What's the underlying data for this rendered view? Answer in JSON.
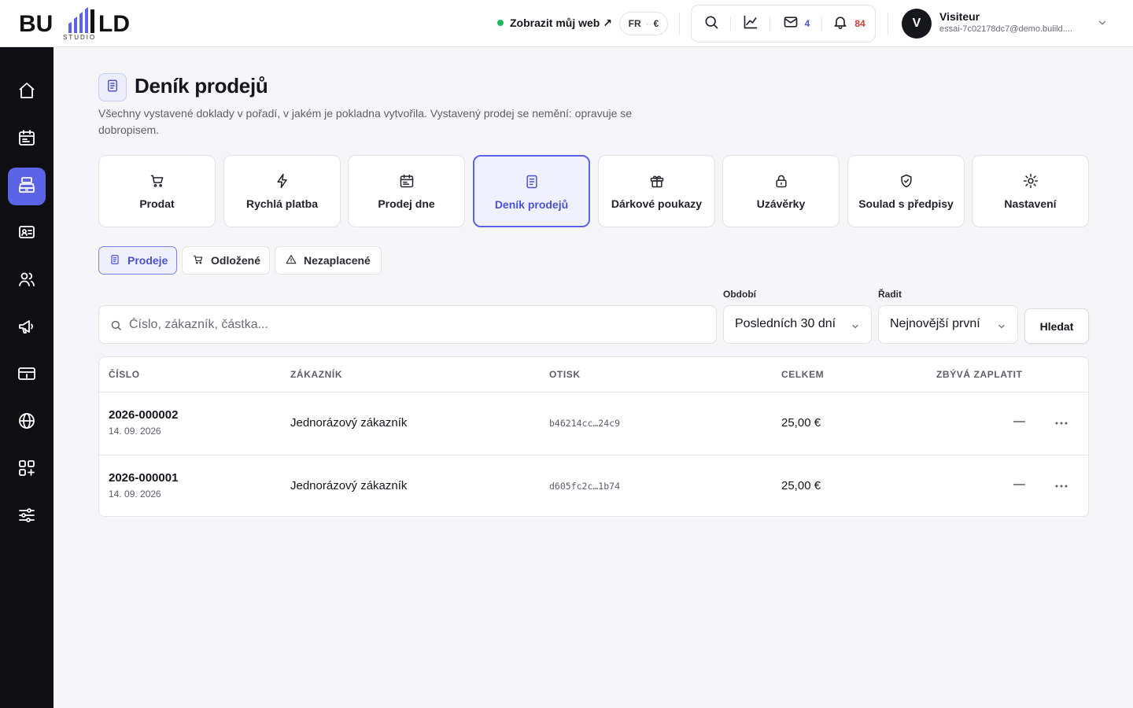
{
  "brand": {
    "logo_text_left": "BU",
    "logo_text_right": "LD",
    "logo_sub": "STUDIO"
  },
  "header": {
    "view_site": "Zobrazit můj web ↗",
    "lang": "FR",
    "lang_sep": "·",
    "currency": "€",
    "messages_count": "4",
    "notifications_count": "84",
    "user": {
      "initial": "V",
      "name": "Visiteur",
      "email": "essai-7c02178dc7@demo.buiild...."
    },
    "icons": [
      "search-icon",
      "chart-icon",
      "mail-icon",
      "bell-icon",
      "chevron-down-icon"
    ]
  },
  "sidebar": {
    "items": [
      {
        "icon": "home-icon"
      },
      {
        "icon": "calendar-icon"
      },
      {
        "icon": "cash-register-icon",
        "active": true
      },
      {
        "icon": "contact-card-icon"
      },
      {
        "icon": "users-icon"
      },
      {
        "icon": "megaphone-icon"
      },
      {
        "icon": "payment-card-icon"
      },
      {
        "icon": "globe-icon"
      },
      {
        "icon": "apps-add-icon"
      },
      {
        "icon": "sliders-icon"
      }
    ]
  },
  "page": {
    "title": "Deník prodejů",
    "description": "Všechny vystavené doklady v pořadí, v jakém je pokladna vytvořila. Vystavený prodej se nemění: opravuje se dobropisem."
  },
  "tiles": [
    {
      "label": "Prodat",
      "icon": "cart-icon"
    },
    {
      "label": "Rychlá platba",
      "icon": "bolt-icon"
    },
    {
      "label": "Prodej dne",
      "icon": "calendar-icon"
    },
    {
      "label": "Deník prodejů",
      "icon": "receipt-icon",
      "active": true
    },
    {
      "label": "Dárkové poukazy",
      "icon": "gift-icon"
    },
    {
      "label": "Uzávěrky",
      "icon": "lock-icon"
    },
    {
      "label": "Soulad s předpisy",
      "icon": "shield-check-icon"
    },
    {
      "label": "Nastavení",
      "icon": "sun-gear-icon"
    }
  ],
  "subtabs": [
    {
      "label": "Prodeje",
      "icon": "receipt-icon",
      "active": true
    },
    {
      "label": "Odložené",
      "icon": "cart-icon"
    },
    {
      "label": "Nezaplacené",
      "icon": "warning-icon"
    }
  ],
  "filters": {
    "search_placeholder": "Číslo, zákazník, částka...",
    "search_value": "",
    "period_label": "Období",
    "period_value": "Posledních 30 dní",
    "sort_label": "Řadit",
    "sort_value": "Nejnovější první",
    "search_button": "Hledat"
  },
  "table": {
    "columns": [
      "ČÍSLO",
      "ZÁKAZNÍK",
      "OTISK",
      "CELKEM",
      "ZBÝVÁ ZAPLATIT"
    ],
    "rows": [
      {
        "number": "2026-000002",
        "date": "14. 09. 2026",
        "customer": "Jednorázový zákazník",
        "hash": "b46214cc…24c9",
        "total": "25,00 €",
        "due": "—"
      },
      {
        "number": "2026-000001",
        "date": "14. 09. 2026",
        "customer": "Jednorázový zákazník",
        "hash": "d605fc2c…1b74",
        "total": "25,00 €",
        "due": "—"
      }
    ]
  },
  "colors": {
    "accent": "#5b63e6",
    "sidebar_bg": "#0f0f13",
    "status_online": "#1fb85a",
    "badge_blue": "#4a52d1",
    "badge_red": "#d23a3a"
  }
}
